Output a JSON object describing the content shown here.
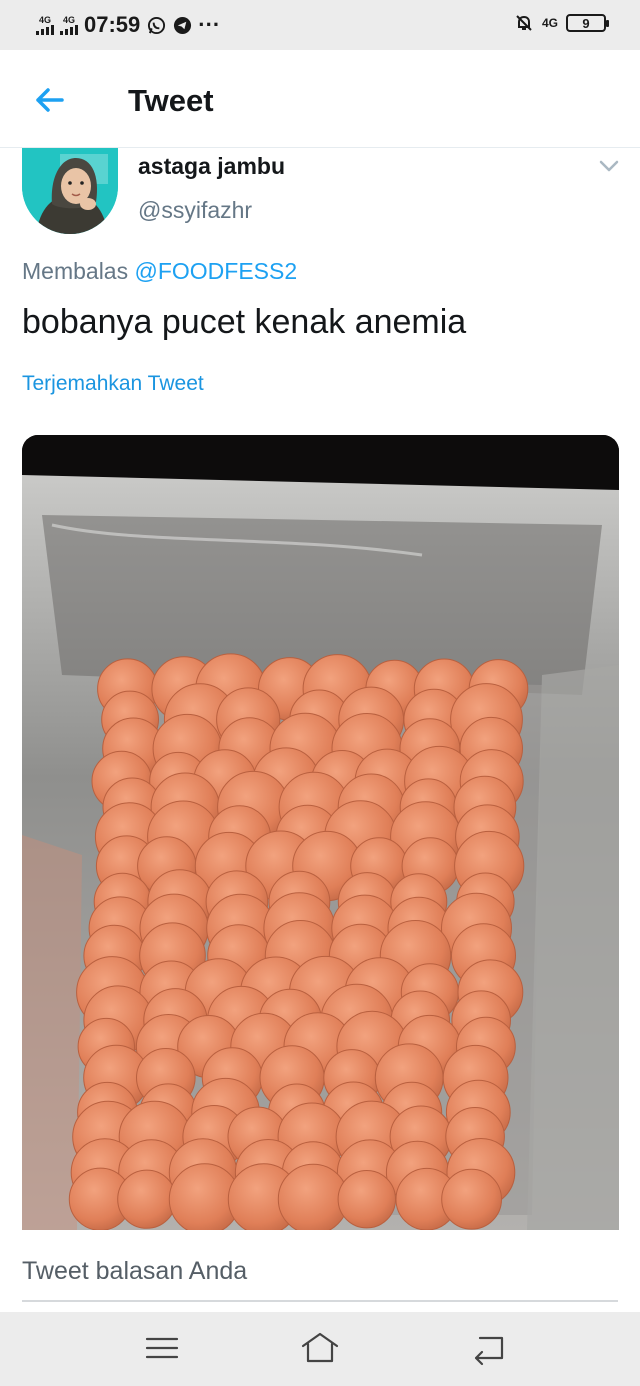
{
  "status_bar": {
    "network_1": "4G",
    "network_2": "4G",
    "time": "07:59",
    "icons": [
      "whatsapp-icon",
      "telegram-icon",
      "more-dots-icon",
      "mute-bell-icon"
    ],
    "more": "···",
    "mobile_data": "4G",
    "battery_level": "9"
  },
  "header": {
    "title": "Tweet",
    "back_icon": "arrow-left-icon"
  },
  "tweet": {
    "author_name": "astaga jambu",
    "author_handle": "@ssyifazhr",
    "reply_prefix": "Membalas",
    "reply_mention": "@FOODFESS2",
    "text": "bobanya pucet kenak anemia",
    "translate_label": "Terjemahkan Tweet"
  },
  "reply": {
    "placeholder": "Tweet balasan Anda"
  },
  "nav_bar": {
    "icons": [
      "menu-icon",
      "home-icon",
      "back-icon"
    ]
  },
  "colors": {
    "accent": "#1da1f2",
    "text_primary": "#14171a",
    "text_secondary": "#657786",
    "status_bar_bg": "#ececec",
    "boba": "#e8875e"
  }
}
